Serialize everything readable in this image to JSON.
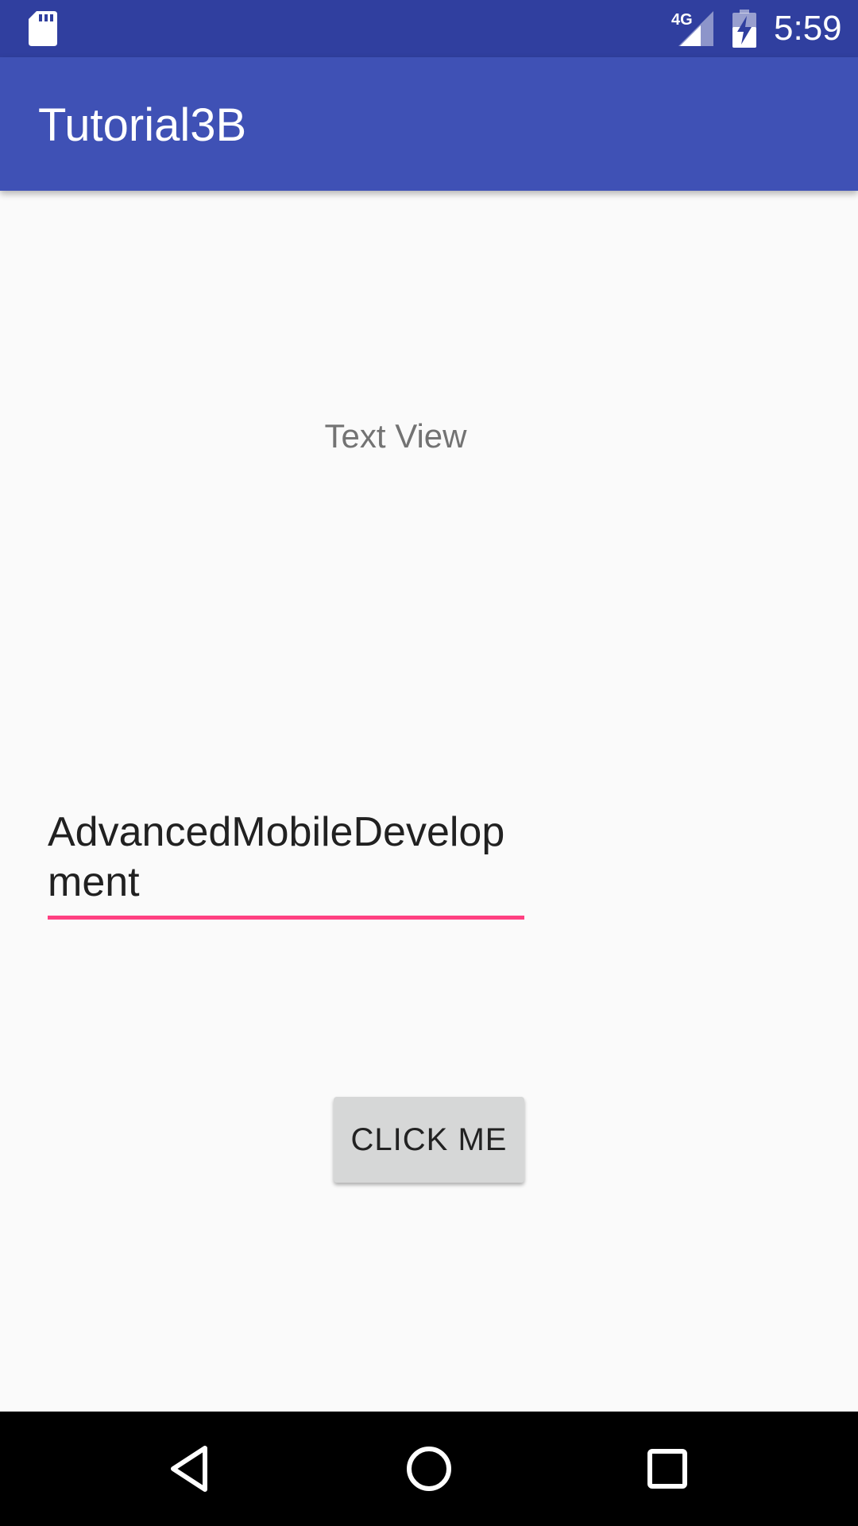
{
  "status_bar": {
    "network_type": "4G",
    "time": "5:59",
    "icons": [
      "sd-card-icon",
      "cell-signal-icon",
      "battery-charging-icon"
    ]
  },
  "app_bar": {
    "title": "Tutorial3B"
  },
  "main": {
    "text_view": "Text View",
    "edit_text_value": "AdvancedMobileDevelopment",
    "button_label": "CLICK ME"
  },
  "nav_bar": {
    "icons": [
      "back-icon",
      "home-icon",
      "recents-icon"
    ]
  },
  "colors": {
    "status_bar": "#303f9f",
    "app_bar": "#3f51b5",
    "accent": "#ff4081",
    "background": "#fafafa",
    "button": "#d6d7d7"
  }
}
